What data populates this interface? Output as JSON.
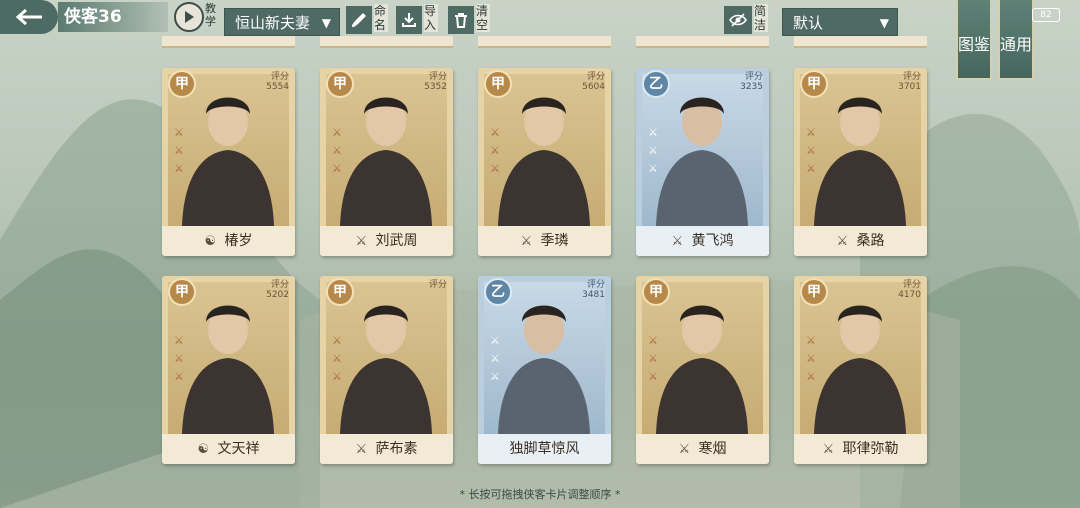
{
  "header": {
    "title": "侠客36",
    "teach_label": "教学",
    "team_select": "恒山新夫妻",
    "rename_label": "命名",
    "import_label": "导入",
    "clear_label": "清空",
    "concise_label": "简洁",
    "sort_select": "默认",
    "atlas_tab": "图鉴",
    "general_tab": "通用",
    "battery": "82"
  },
  "cards": [
    {
      "name": "椿岁",
      "grade": "甲",
      "score_label": "评分",
      "score": "5554",
      "tier": "gold",
      "name_icon": "yin-yang-icon"
    },
    {
      "name": "刘武周",
      "grade": "甲",
      "score_label": "评分",
      "score": "5352",
      "tier": "gold",
      "name_icon": "sword-icon"
    },
    {
      "name": "季璘",
      "grade": "甲",
      "score_label": "评分",
      "score": "5604",
      "tier": "gold",
      "name_icon": "sword-icon"
    },
    {
      "name": "黄飞鸿",
      "grade": "乙",
      "score_label": "评分",
      "score": "3235",
      "tier": "blue",
      "name_icon": "sword-icon"
    },
    {
      "name": "桑路",
      "grade": "甲",
      "score_label": "评分",
      "score": "3701",
      "tier": "gold",
      "name_icon": "sword-icon"
    },
    {
      "name": "文天祥",
      "grade": "甲",
      "score_label": "评分",
      "score": "5202",
      "tier": "gold",
      "name_icon": "yin-yang-icon"
    },
    {
      "name": "萨布素",
      "grade": "甲",
      "score_label": "评分",
      "score": "",
      "tier": "gold",
      "name_icon": "sword-icon"
    },
    {
      "name": "独脚草惊风",
      "grade": "乙",
      "score_label": "评分",
      "score": "3481",
      "tier": "blue",
      "name_icon": ""
    },
    {
      "name": "寒烟",
      "grade": "甲",
      "score_label": "",
      "score": "",
      "tier": "gold",
      "name_icon": "sword-icon"
    },
    {
      "name": "耶律弥勒",
      "grade": "甲",
      "score_label": "评分",
      "score": "4170",
      "tier": "gold",
      "name_icon": "sword-icon"
    }
  ],
  "footer_hint": "* 长按可拖拽侠客卡片调整顺序 *",
  "colors": {
    "gold_card": "#e6d3a6",
    "blue_card": "#b9cfe0",
    "toolbar": "#4f6a63"
  }
}
